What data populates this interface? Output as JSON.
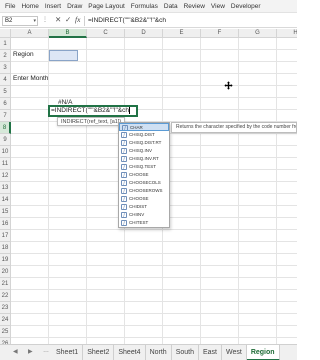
{
  "menu": [
    "File",
    "Home",
    "Insert",
    "Draw",
    "Page Layout",
    "Formulas",
    "Data",
    "Review",
    "View",
    "Developer"
  ],
  "formula_bar": {
    "name_box": "B2",
    "more_dots": "⋮",
    "cancel_glyph": "✕",
    "enter_glyph": "✓",
    "fx_label": "fx",
    "content": "=INDIRECT(\"'\"&B2&\"'!\"&ch"
  },
  "columns": [
    "A",
    "B",
    "C",
    "D",
    "E",
    "F",
    "G",
    "H"
  ],
  "rows": [
    "1",
    "2",
    "3",
    "4",
    "5",
    "6",
    "7",
    "8",
    "9",
    "10",
    "11",
    "12",
    "13",
    "14",
    "15",
    "16",
    "17",
    "18",
    "19",
    "20",
    "21",
    "22",
    "23",
    "24",
    "25",
    "26"
  ],
  "cells": {
    "a2": "Region",
    "a4": "Enter Month",
    "b6": "#N/A",
    "b8_formula": "=INDIRECT(\"'\"&B2&\"'!\"&ch"
  },
  "tooltip": "INDIRECT(ref_text, [a1])",
  "autocomplete": {
    "items": [
      "CHAR",
      "CHISQ.DIST",
      "CHISQ.DIST.RT",
      "CHISQ.INV",
      "CHISQ.INV.RT",
      "CHISQ.TEST",
      "CHOOSE",
      "CHOOSECOLS",
      "CHOOSEROWS",
      "CHOOSE",
      "CHIDIST",
      "CHIINV",
      "CHITEST"
    ],
    "selected": "CHAR",
    "description": "Returns the character specified by the code number from the chara"
  },
  "sheet_tabs": [
    "Sheet1",
    "Sheet2",
    "Sheet4",
    "North",
    "South",
    "East",
    "West",
    "Region"
  ],
  "active_tab": "Region",
  "nav": {
    "prev": "◀",
    "next": "▶",
    "more": "…"
  },
  "colors": {
    "accent": "#217346",
    "selection": "#dde6f5",
    "autocomplete_highlight": "#cfe0f3"
  }
}
